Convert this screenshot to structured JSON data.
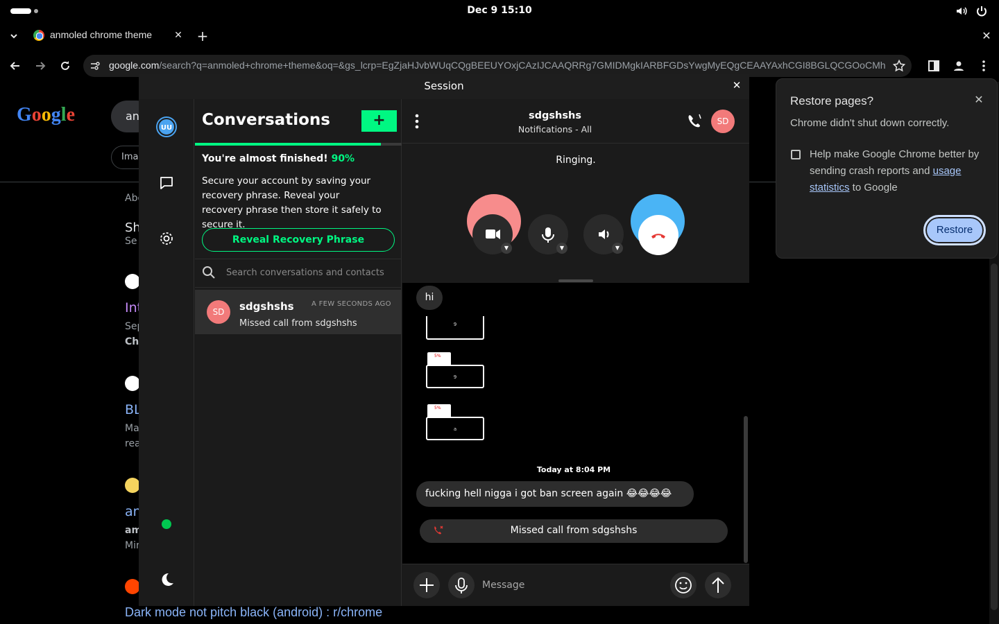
{
  "system": {
    "clock": "Dec 9  15:10",
    "icons": [
      "volume-icon",
      "power-icon"
    ]
  },
  "browser": {
    "tab_title": "anmoled chrome theme",
    "url_host": "google.com",
    "url_rest": "/search?q=anmoled+chrome+theme&oq=&gs_lcrp=EgZjaHJvbWUqCQgBEEUYOxjCAzIJCAAQRRg7GMIDMgkIARBFGDsYwgMyEQgCEAAYAxhCGI8BGLQCGOoCMhEI…"
  },
  "google": {
    "logo": "Google",
    "search_value": "an",
    "images_chip": "Ima",
    "about_text": "Abo",
    "result_snippets": [
      "Sh",
      "Se",
      "Int",
      "Sep",
      "Ch",
      "BL",
      "Ma",
      "rea",
      "an",
      "am",
      "Mir"
    ],
    "dark_mode_link": "Dark mode not pitch black (android) : r/chrome"
  },
  "restore_popup": {
    "title": "Restore pages?",
    "subtitle": "Chrome didn't shut down correctly.",
    "help_text_before": "Help make Google Chrome better by sending crash reports and ",
    "help_link": "usage statistics",
    "help_text_after": " to Google",
    "restore_button": "Restore"
  },
  "session": {
    "window_title": "Session",
    "user_avatar": "UU",
    "conversations_title": "Conversations",
    "add_button": "+",
    "progress_percent": 90,
    "almost_finished": "You're almost finished!",
    "almost_pct": "90%",
    "secure_text": "Secure your account by saving your recovery phrase. Reveal your recovery phrase then store it safely to secure it.",
    "reveal_button": "Reveal Recovery Phrase",
    "search_placeholder": "Search conversations and contacts",
    "conversation": {
      "avatar": "SD",
      "name": "sdgshshs",
      "time": "A FEW SECONDS AGO",
      "preview": "Missed call from sdgshshs"
    }
  },
  "chat": {
    "name": "sdgshshs",
    "subtitle": "Notifications - All",
    "avatar": "SD",
    "call_status": "Ringing.",
    "messages": {
      "hi": "hi",
      "thumb_labels": [
        "9",
        "9",
        "a"
      ],
      "thumb_tabs": [
        "5%",
        "5%"
      ],
      "timestamp": "Today at 8:04 PM",
      "long_message": "fucking hell nigga i got ban screen again 😂😂😂😂",
      "missed_call": "Missed call from sdgshshs"
    },
    "composer_placeholder": "Message"
  },
  "colors": {
    "session_accent": "#00f782",
    "session_bg": "#1b1b1b",
    "avatar_pink": "#f27a7a",
    "call_blue": "#4ab4f5",
    "restore_button": "#a8c7fa"
  }
}
